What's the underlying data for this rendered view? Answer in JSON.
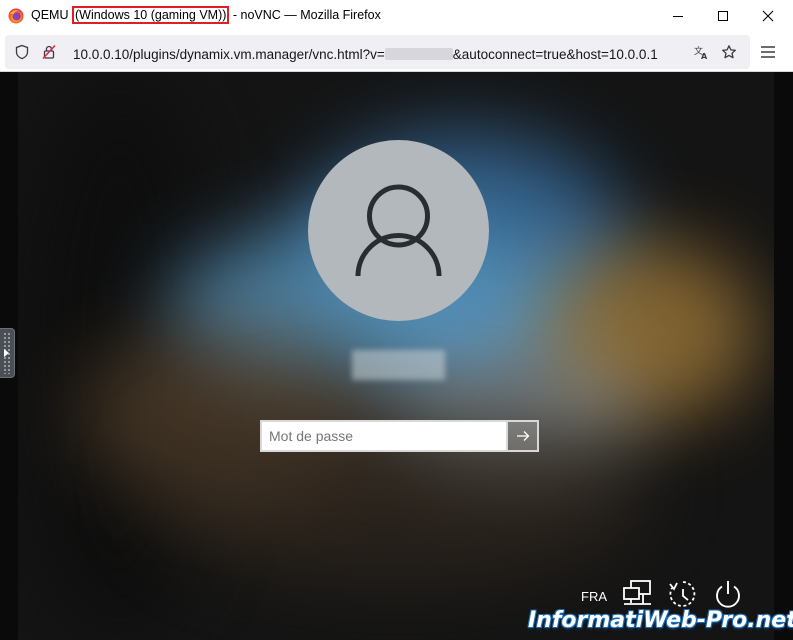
{
  "window": {
    "title_prefix": "QEMU ",
    "title_highlight": "(Windows 10 (gaming VM))",
    "title_suffix": " - noVNC — Mozilla Firefox",
    "icons": [
      "firefox-logo",
      "minimize-icon",
      "maximize-icon",
      "close-icon"
    ]
  },
  "address_bar": {
    "url_start": "10.0.0.10/plugins/dynamix.vm.manager/vnc.html?v=",
    "url_end": "&autoconnect=true&host=10.0.0.1",
    "icons": [
      "shield-icon",
      "insecure-lock-icon",
      "translate-icon",
      "bookmark-star-icon",
      "hamburger-menu-icon"
    ]
  },
  "login": {
    "password_placeholder": "Mot de passe",
    "submit_icon": "arrow-right-icon"
  },
  "system_tray": {
    "language": "FRA",
    "icons": [
      "network-icon",
      "ease-of-access-icon",
      "power-icon"
    ]
  },
  "watermark": "InformatiWeb-Pro.net",
  "colors": {
    "highlight_border": "#e02020",
    "address_bg": "#f0f0f4",
    "avatar_bg": "#b3b8bd"
  }
}
